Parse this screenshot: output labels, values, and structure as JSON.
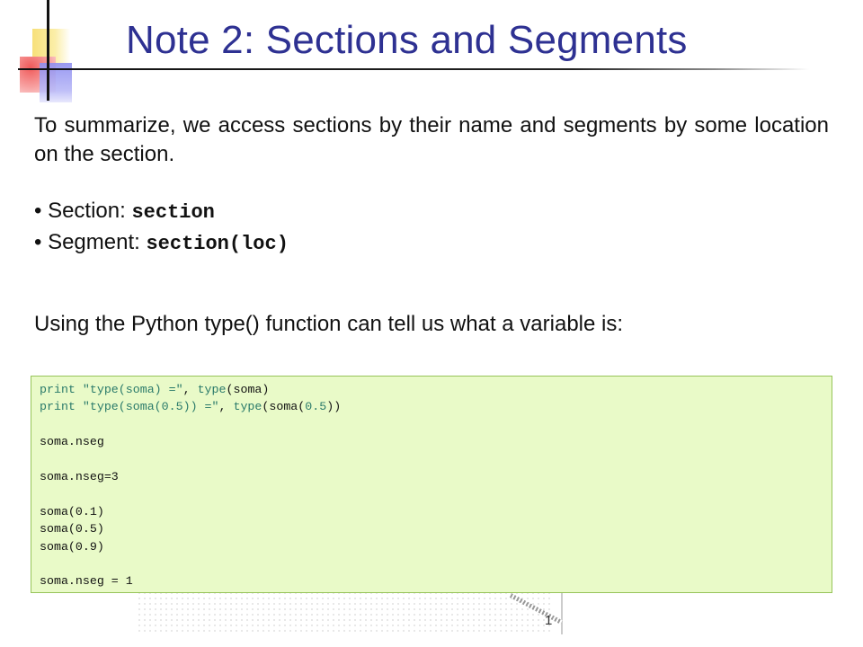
{
  "slide": {
    "title": "Note 2: Sections and Segments",
    "intro": "To summarize, we access sections by their name and segments by some location on the section.",
    "bullets": [
      {
        "label": "• Section: ",
        "code": "section"
      },
      {
        "label": "• Segment: ",
        "code": "section(loc)"
      }
    ],
    "type_note": "Using the Python type() function can tell us what a variable is:"
  },
  "code": {
    "l1_kw": "print",
    "l1_str": "\"type(soma) =\"",
    "l1_sep": ", ",
    "l1_fn": "type",
    "l1_arg": "(soma)",
    "l2_kw": "print",
    "l2_str": "\"type(soma(0.5)) =\"",
    "l2_sep": ", ",
    "l2_fn": "type",
    "l2_pre": "(soma(",
    "l2_num": "0.5",
    "l2_post": "))",
    "l3": "soma.nseg",
    "l4": "soma.nseg=3",
    "l5": "soma(0.1)",
    "l6": "soma(0.5)",
    "l7": "soma(0.9)",
    "l8": "soma.nseg = 1"
  },
  "figure": {
    "label": "1"
  },
  "colors": {
    "title": "#2e3192",
    "code_bg": "#e9fac8",
    "code_border": "#97c45a",
    "code_keyword": "#2a7a6a"
  }
}
